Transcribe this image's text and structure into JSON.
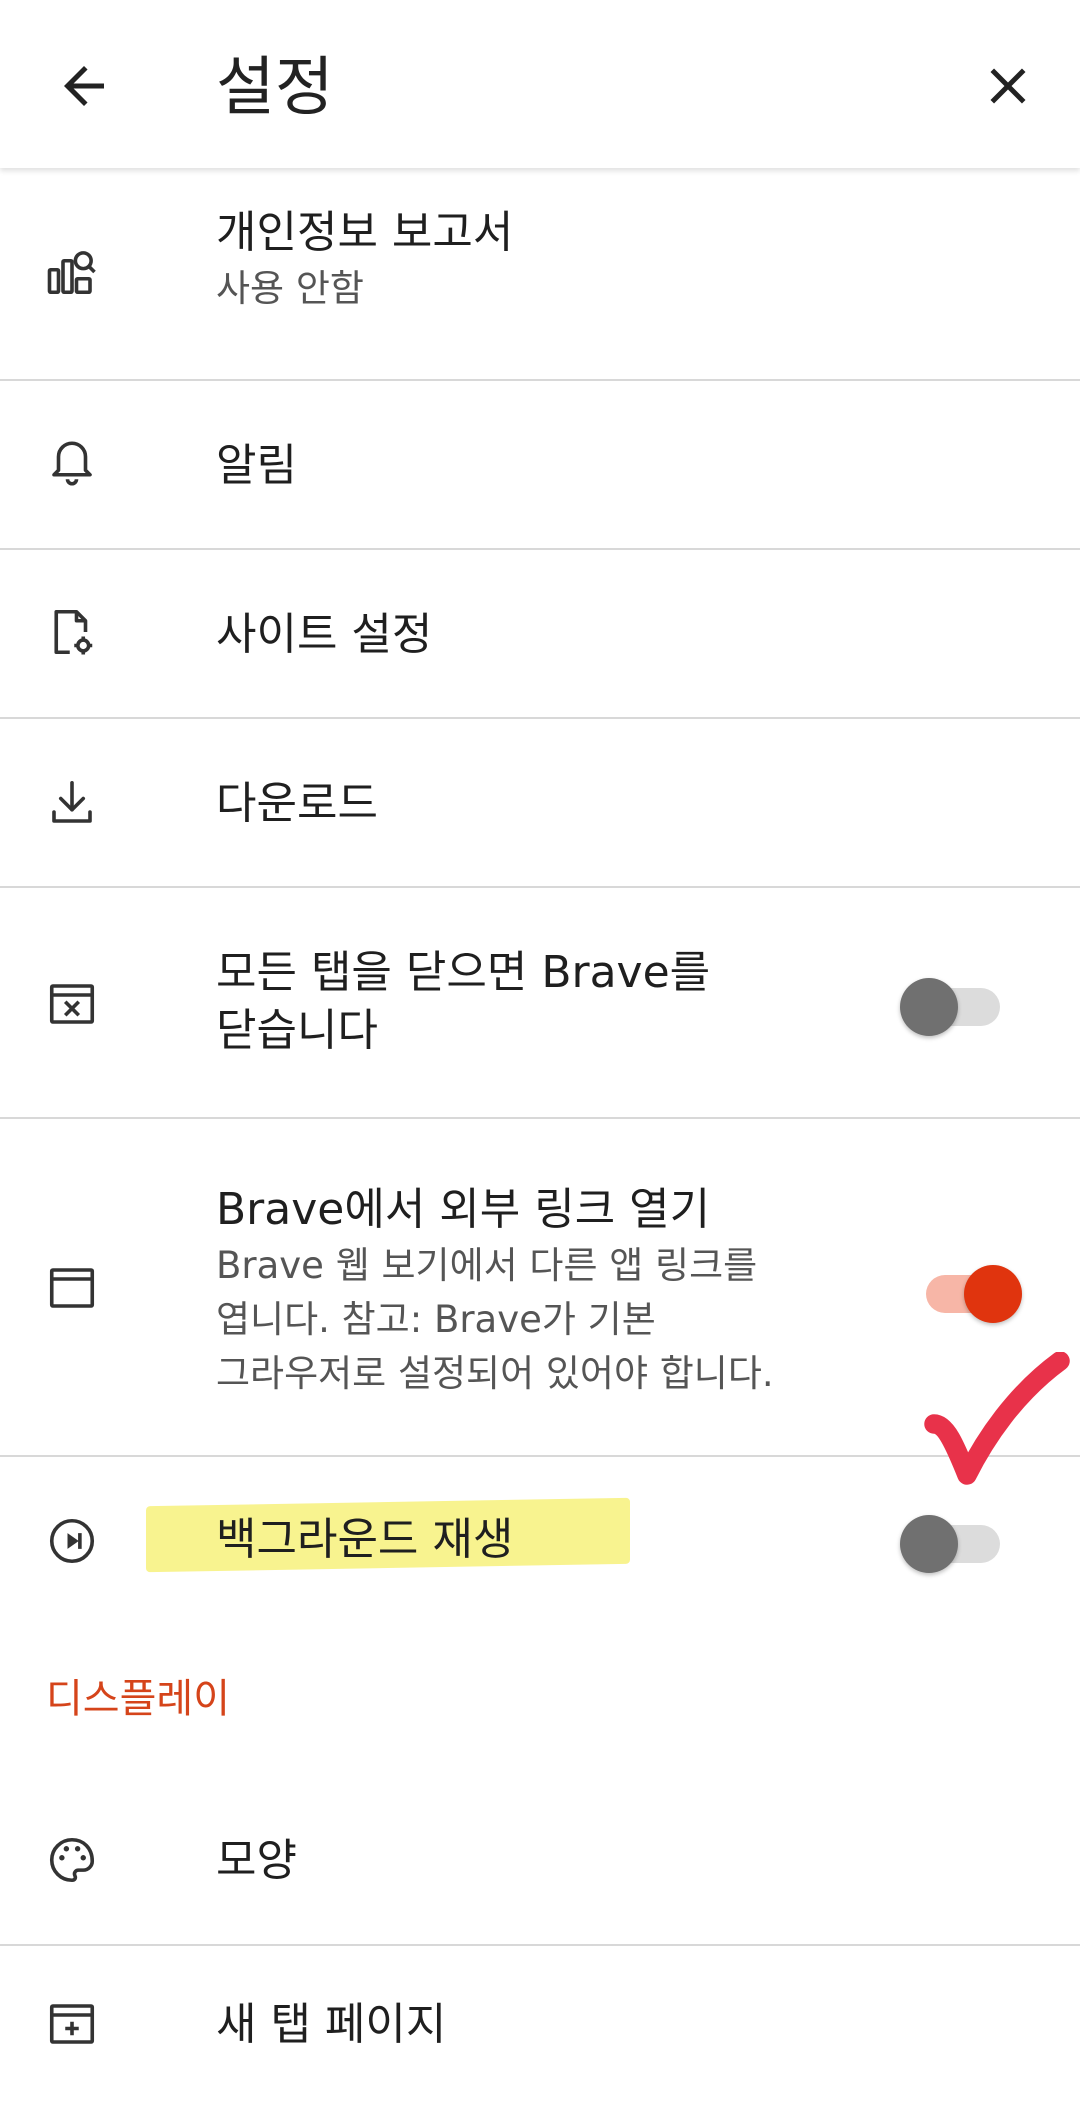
{
  "app_bar": {
    "title": "설정",
    "back_icon": "arrow-left-icon",
    "close_icon": "close-icon"
  },
  "settings": {
    "privacy_report": {
      "label": "개인정보 보고서",
      "sublabel": "사용 안함",
      "icon": "privacy-report-icon"
    },
    "notifications": {
      "label": "알림",
      "icon": "bell-icon"
    },
    "site_settings": {
      "label": "사이트 설정",
      "icon": "site-settings-icon"
    },
    "downloads": {
      "label": "다운로드",
      "icon": "download-icon"
    },
    "close_all_tabs": {
      "label_line1": "모든 탭을 닫으면 Brave를",
      "label_line2": "닫습니다",
      "icon": "close-tab-icon",
      "toggle_on": false
    },
    "open_external_links": {
      "label": "Brave에서 외부 링크 열기",
      "desc_line1": "Brave 웹 보기에서 다른 앱 링크를",
      "desc_line2": "엽니다. 참고: Brave가 기본",
      "desc_line3": "그라우저로 설정되어 있어야 합니다.",
      "icon": "window-icon",
      "toggle_on": true
    },
    "background_play": {
      "label": "백그라운드 재생",
      "icon": "play-circle-icon",
      "toggle_on": false
    }
  },
  "display_section": {
    "header": "디스플레이",
    "appearance": {
      "label": "모양",
      "icon": "palette-icon"
    },
    "new_tab_page": {
      "label": "새 탭 페이지",
      "icon": "add-box-icon"
    }
  },
  "colors": {
    "accent": "#e0340e",
    "section_header": "#d5441a",
    "highlight": "#f7f283",
    "checkmark": "#e8324a"
  }
}
